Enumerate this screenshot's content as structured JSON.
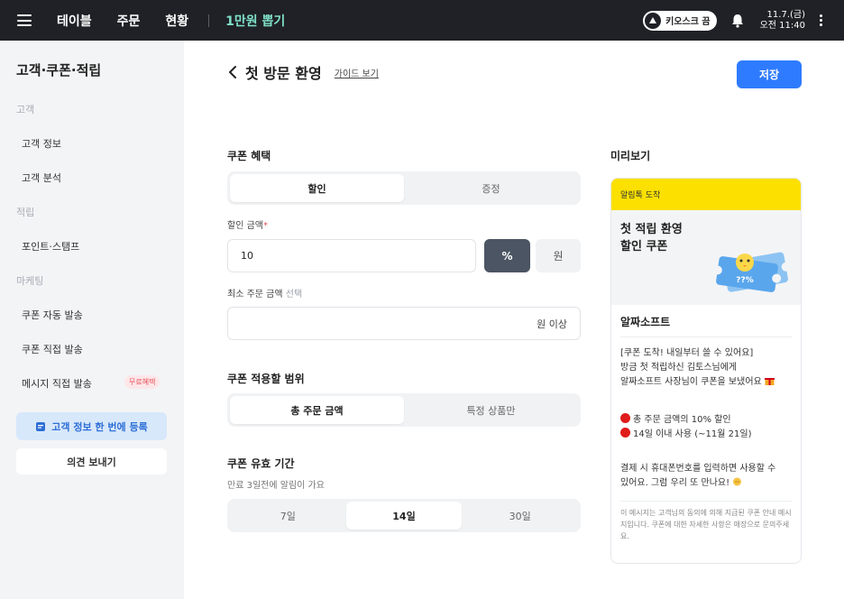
{
  "topbar": {
    "nav": [
      "테이블",
      "주문",
      "현황"
    ],
    "accent_nav": "1만원 뽑기",
    "kiosk_label": "키오스크 끔",
    "date": "11.7.(금)",
    "time": "오전 11:40"
  },
  "sidebar": {
    "title": "고객·쿠폰·적립",
    "group_customer": "고객",
    "item_customer_info": "고객 정보",
    "item_customer_analysis": "고객 분석",
    "group_points": "적립",
    "item_points_stamp": "포인트·스탬프",
    "group_marketing": "마케팅",
    "item_coupon_auto": "쿠폰 자동 발송",
    "item_coupon_direct": "쿠폰 직접 발송",
    "item_message_direct": "메시지 직접 발송",
    "badge_free": "무료혜택",
    "btn_register": "고객 정보 한 번에 등록",
    "btn_feedback": "의견 보내기"
  },
  "header": {
    "title": "첫 방문 환영",
    "guide": "가이드 보기",
    "save": "저장"
  },
  "form": {
    "benefit_label": "쿠폰 혜택",
    "benefit_options": [
      "할인",
      "증정"
    ],
    "discount_label": "할인 금액",
    "discount_required": "*",
    "discount_value": "10",
    "unit_percent": "%",
    "unit_won": "원",
    "min_order_label": "최소 주문 금액",
    "min_order_optional": "선택",
    "min_order_suffix": "원 이상",
    "scope_label": "쿠폰 적용할 범위",
    "scope_options": [
      "총 주문 금액",
      "특정 상품만"
    ],
    "validity_label": "쿠폰 유효 기간",
    "validity_note": "만료 3일전에 알림이 가요",
    "validity_options": [
      "7일",
      "14일",
      "30일"
    ]
  },
  "preview": {
    "label": "미리보기",
    "top": "알림톡 도착",
    "hero_line1": "첫 적립 환영",
    "hero_line2": "할인 쿠폰",
    "coupon_text": "??%",
    "brand": "알짜소프트",
    "msg1_line1": "[쿠폰 도착! 내일부터 쓸 수 있어요]",
    "msg1_line2": "방금 첫 적립하신 김토스님에게",
    "msg1_line3": "알짜소프트 사장님이 쿠폰을 보냈어요",
    "bullet1": "총 주문 금액의 10% 할인",
    "bullet2": "14일 이내 사용 (~11월 21일)",
    "msg2_line1": "결제 시 휴대폰번호를 입력하면 사용할 수",
    "msg2_line2": "있어요. 그럼 우리 또 만나요!",
    "disclaimer": "이 메시지는 고객님의 동의에 의해 지급된 쿠폰 안내 메시지입니다. 쿠폰에 대한 자세한 사항은 매장으로 문의주세요."
  }
}
